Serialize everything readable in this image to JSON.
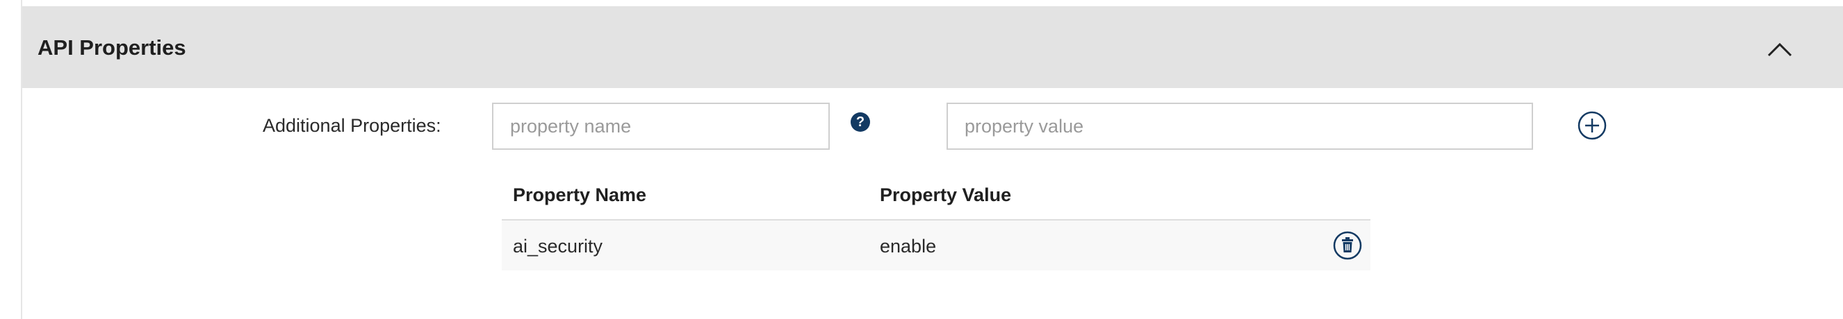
{
  "section": {
    "title": "API Properties"
  },
  "form": {
    "label": "Additional Properties:",
    "name_placeholder": "property name",
    "value_placeholder": "property value",
    "help_glyph": "?"
  },
  "table": {
    "headers": [
      "Property Name",
      "Property Value"
    ],
    "rows": [
      {
        "name": "ai_security",
        "value": "enable"
      }
    ]
  },
  "colors": {
    "header_bg": "#e3e3e3",
    "accent": "#133a63"
  },
  "icons": {
    "collapse": "chevron-up-icon",
    "help": "question-circle-icon",
    "add": "plus-circle-icon",
    "delete": "trash-icon"
  }
}
